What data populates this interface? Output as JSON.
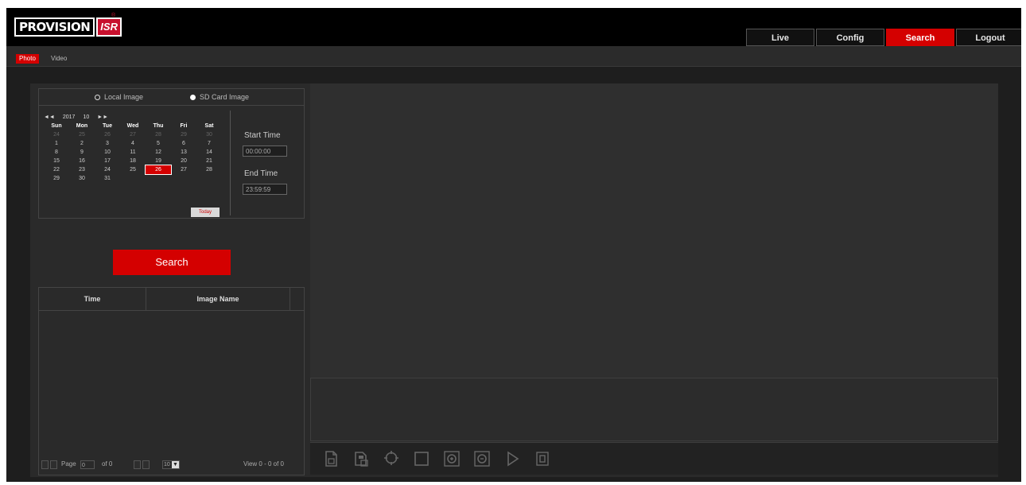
{
  "app": {
    "logo_text": "PROVISION",
    "logo_badge": "ISR"
  },
  "nav": {
    "items": [
      {
        "label": "Live",
        "active": false
      },
      {
        "label": "Config",
        "active": false
      },
      {
        "label": "Search",
        "active": true
      },
      {
        "label": "Logout",
        "active": false
      }
    ]
  },
  "subtabs": [
    {
      "label": "Photo",
      "active": true
    },
    {
      "label": "Video",
      "active": false
    }
  ],
  "source": {
    "local_label": "Local Image",
    "sd_label": "SD Card Image",
    "selected": "sd"
  },
  "calendar": {
    "year": "2017",
    "month": "10",
    "prev_symbol": "◄◄",
    "next_symbol": "►►",
    "day_names": [
      "Sun",
      "Mon",
      "Tue",
      "Wed",
      "Thu",
      "Fri",
      "Sat"
    ],
    "weeks": [
      [
        "24",
        "25",
        "26",
        "27",
        "28",
        "29",
        "30"
      ],
      [
        "1",
        "2",
        "3",
        "4",
        "5",
        "6",
        "7"
      ],
      [
        "8",
        "9",
        "10",
        "11",
        "12",
        "13",
        "14"
      ],
      [
        "15",
        "16",
        "17",
        "18",
        "19",
        "20",
        "21"
      ],
      [
        "22",
        "23",
        "24",
        "25",
        "26",
        "27",
        "28"
      ],
      [
        "29",
        "30",
        "31",
        "",
        "",
        "",
        ""
      ]
    ],
    "selected_day": "26",
    "today_label": "Today"
  },
  "time": {
    "start_label": "Start Time",
    "start_value": "00:00:00",
    "end_label": "End Time",
    "end_value": "23:59:59"
  },
  "search_button": "Search",
  "table": {
    "columns": [
      "Time",
      "Image Name"
    ],
    "rows": []
  },
  "pager": {
    "page_label": "Page",
    "page_value": "0",
    "of_label": "of 0",
    "per_page": "10",
    "view_label": "View 0 - 0 of 0"
  },
  "toolbar": {
    "icons": [
      "open-file-icon",
      "save-file-icon",
      "zoom-fit-icon",
      "original-size-icon",
      "zoom-in-icon",
      "zoom-out-icon",
      "play-icon",
      "stop-icon"
    ]
  }
}
